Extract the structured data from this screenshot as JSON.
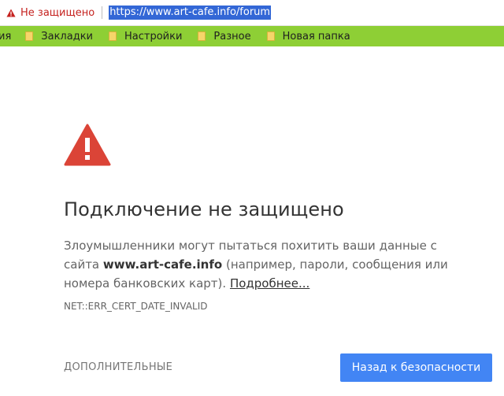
{
  "address_bar": {
    "security_label": "Не защищено",
    "url": "https://www.art-cafe.info/forum"
  },
  "bookmarks": {
    "partial_item": "ия",
    "folders": [
      "Закладки",
      "Настройки",
      "Разное",
      "Новая папка"
    ]
  },
  "interstitial": {
    "heading": "Подключение не защищено",
    "explanation_part1": "Злоумышленники могут пытаться похитить ваши данные с сайта",
    "domain": "www.art-cafe.info",
    "explanation_part2": "(например, пароли, сообщения или номера банковских карт).",
    "details_link": "Подробнее...",
    "error_code": "NET::ERR_CERT_DATE_INVALID",
    "advanced_button": "ДОПОЛНИТЕЛЬНЫЕ",
    "back_button": "Назад к безопасности"
  },
  "colors": {
    "warning_red": "#db4437",
    "bookmarks_bar": "#8ecf35",
    "primary_button": "#4285f4",
    "url_selection": "#3367d6"
  },
  "icons": {
    "address_warning": "warning-triangle-icon",
    "bookmark_folder": "folder-icon",
    "main_warning": "warning-triangle-icon"
  }
}
